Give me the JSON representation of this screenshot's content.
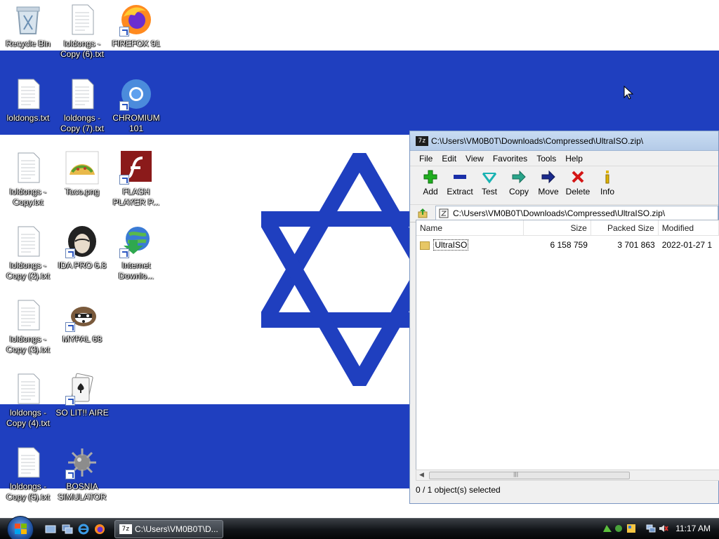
{
  "desktop": {
    "icons": [
      {
        "label": "Recycle Bin",
        "icon": "recycle-bin-icon"
      },
      {
        "label": "loldongs - Copy (6).txt",
        "icon": "text-file-icon"
      },
      {
        "label": "FIREFOX 91",
        "icon": "firefox-icon"
      },
      {
        "label": "loldongs.txt",
        "icon": "text-file-icon"
      },
      {
        "label": "loldongs - Copy (7).txt",
        "icon": "text-file-icon"
      },
      {
        "label": "CHROMIUM 101",
        "icon": "chromium-icon"
      },
      {
        "label": "loldongs - Copy.txt",
        "icon": "text-file-icon"
      },
      {
        "label": "Taco.png",
        "icon": "taco-image-icon"
      },
      {
        "label": "FLASH PLAYER P...",
        "icon": "flash-player-icon"
      },
      {
        "label": "loldongs - Copy (2).txt",
        "icon": "text-file-icon"
      },
      {
        "label": "IDA PRO 6.8",
        "icon": "ida-pro-icon"
      },
      {
        "label": "Internet Downlo...",
        "icon": "internet-download-manager-icon"
      },
      {
        "label": "loldongs - Copy (3).txt",
        "icon": "text-file-icon"
      },
      {
        "label": "MYPAL 68",
        "icon": "mypal-icon"
      },
      {
        "label": "loldongs - Copy (4).txt",
        "icon": "text-file-icon"
      },
      {
        "label": "SO LIT!! AIRE",
        "icon": "solitaire-icon"
      },
      {
        "label": "loldongs - Copy (5).txt",
        "icon": "text-file-icon"
      },
      {
        "label": "BOSNIA SIMULATOR",
        "icon": "bosnia-simulator-icon"
      }
    ]
  },
  "window": {
    "title": "C:\\Users\\VM0B0T\\Downloads\\Compressed\\UltraISO.zip\\",
    "app_icon_text": "7z",
    "menu": [
      "File",
      "Edit",
      "View",
      "Favorites",
      "Tools",
      "Help"
    ],
    "toolbar": [
      "Add",
      "Extract",
      "Test",
      "Copy",
      "Move",
      "Delete",
      "Info"
    ],
    "address": "C:\\Users\\VM0B0T\\Downloads\\Compressed\\UltraISO.zip\\",
    "columns": [
      "Name",
      "Size",
      "Packed Size",
      "Modified"
    ],
    "rows": [
      {
        "name": "UltraISO",
        "size": "6 158 759",
        "packed": "3 701 863",
        "modified": "2022-01-27 1"
      }
    ],
    "status": "0 / 1 object(s) selected"
  },
  "taskbar": {
    "task_title": "C:\\Users\\VM0B0T\\D...",
    "task_icon_text": "7z",
    "clock": "11:17 AM"
  },
  "colors": {
    "flag_blue": "#1f3fbf",
    "taskbar": "#111418",
    "titlebar": "#b4cbe8"
  }
}
